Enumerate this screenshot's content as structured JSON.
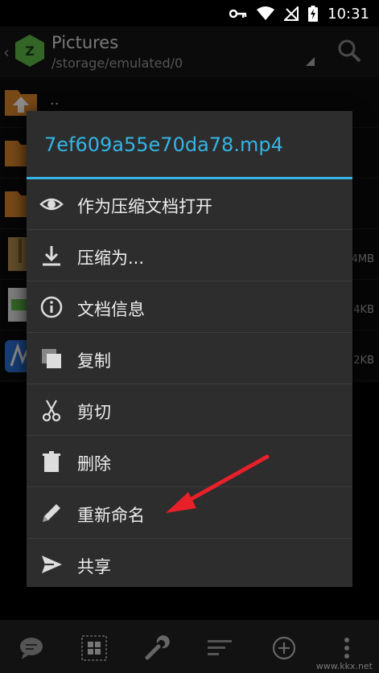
{
  "status_bar": {
    "time": "10:31"
  },
  "app_bar": {
    "title": "Pictures",
    "path": "/storage/emulated/0"
  },
  "files": [
    {
      "name": "..",
      "size": ""
    },
    {
      "name": "",
      "size": ""
    },
    {
      "name": "",
      "size": ""
    },
    {
      "name": "",
      "size": "4MB"
    },
    {
      "name": "",
      "size": "4KB"
    },
    {
      "name": "",
      "size": "2KB"
    }
  ],
  "dialog": {
    "title": "7ef609a55e70da78.mp4",
    "items": [
      {
        "label": "作为压缩文档打开",
        "icon": "eye-icon"
      },
      {
        "label": "压缩为...",
        "icon": "download-icon"
      },
      {
        "label": "文档信息",
        "icon": "info-icon"
      },
      {
        "label": "复制",
        "icon": "copy-icon"
      },
      {
        "label": "剪切",
        "icon": "scissors-icon"
      },
      {
        "label": "删除",
        "icon": "trash-icon"
      },
      {
        "label": "重新命名",
        "icon": "pencil-icon"
      },
      {
        "label": "共享",
        "icon": "share-icon"
      }
    ]
  },
  "watermark": "www.kkx.net",
  "colors": {
    "accent": "#33b5e5",
    "annotation": "#e8202a"
  }
}
